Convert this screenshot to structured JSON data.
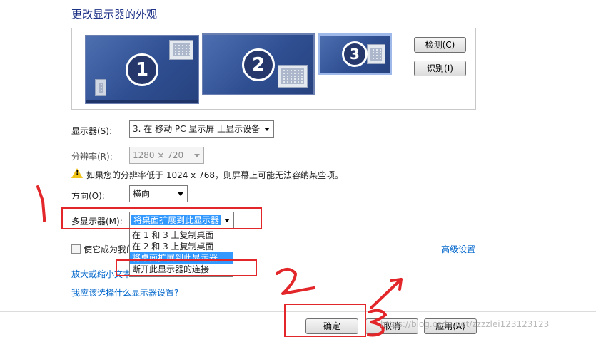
{
  "title": "更改显示器的外观",
  "monitors": [
    {
      "number": "1"
    },
    {
      "number": "2"
    },
    {
      "number": "3"
    }
  ],
  "buttons": {
    "detect": "检测(C)",
    "identify": "识别(I)",
    "ok": "确定",
    "cancel": "取消",
    "apply": "应用(A)"
  },
  "display": {
    "label": "显示器(S):",
    "value": "3. 在 移动 PC 显示屏 上显示设备"
  },
  "resolution": {
    "label": "分辨率(R):",
    "value": "1280 × 720"
  },
  "warning": "如果您的分辨率低于 1024 x 768，则屏幕上可能无法容纳某些项。",
  "orientation": {
    "label": "方向(O):",
    "value": "横向"
  },
  "multi_display": {
    "label": "多显示器(M):",
    "value": "将桌面扩展到此显示器",
    "options": [
      "在 1 和 3 上复制桌面",
      "在 2 和 3 上复制桌面",
      "将桌面扩展到此显示器",
      "断开此显示器的连接"
    ]
  },
  "checkbox_label": "使它成为我的",
  "advanced_link": "高级设置",
  "link_text_size": "放大或缩小文本",
  "link_which_settings": "我应该选择什么显示器设置?",
  "annotations": {
    "a1": "1",
    "a2": "2",
    "a3": "3"
  },
  "watermark": "https://blog.csdn.net/zzzzlei123123123",
  "colors": {
    "accent": "#3399ff",
    "annotation_red": "#e3262a",
    "title": "#1e3287",
    "link": "#0066cc"
  }
}
